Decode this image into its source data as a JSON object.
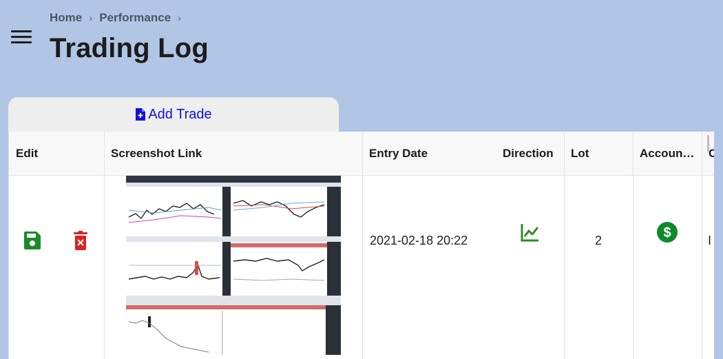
{
  "breadcrumb": {
    "items": [
      "Home",
      "Performance"
    ],
    "separator": "›"
  },
  "page": {
    "title": "Trading Log"
  },
  "add_tab": {
    "label": "Add Trade",
    "icon": "file-plus-icon",
    "color": "#1010dd"
  },
  "grid": {
    "columns": [
      "Edit",
      "Screenshot Link",
      "Entry Date",
      "Direction",
      "Lot",
      "Accoun…",
      "C"
    ],
    "rows": [
      {
        "edit_icons": [
          "save-icon",
          "delete-icon"
        ],
        "screenshot_icon": "trading-chart-screenshot",
        "entry_date": "2021-02-18 20:22",
        "direction_icon": "trending-up-icon",
        "lot": "2",
        "account_icon": "dollar-circle-icon",
        "next_col_partial": "I"
      }
    ]
  },
  "colors": {
    "background": "#b1c6e5",
    "save": "#1b8a2a",
    "delete": "#e02020",
    "direction": "#2e8b22",
    "account": "#0e8a2a"
  }
}
